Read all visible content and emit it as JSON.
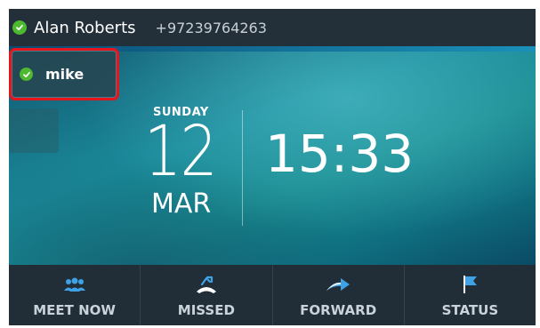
{
  "topbar": {
    "user_name": "Alan Roberts",
    "phone_number": "+97239764263",
    "presence_color": "#4cb92f"
  },
  "contact_tile": {
    "label": "mike",
    "presence_color": "#4cb92f",
    "highlight_color": "#e8131b"
  },
  "clock": {
    "day": "SUNDAY",
    "date": "12",
    "month": "MAR",
    "time": "15:33"
  },
  "softkeys": [
    {
      "label": "MEET NOW",
      "icon": "meet-now-icon"
    },
    {
      "label": "MISSED",
      "icon": "missed-call-icon"
    },
    {
      "label": "FORWARD",
      "icon": "forward-icon"
    },
    {
      "label": "STATUS",
      "icon": "status-flag-icon"
    }
  ],
  "colors": {
    "accent": "#3fa2e6",
    "bar_background": "#222e37"
  }
}
